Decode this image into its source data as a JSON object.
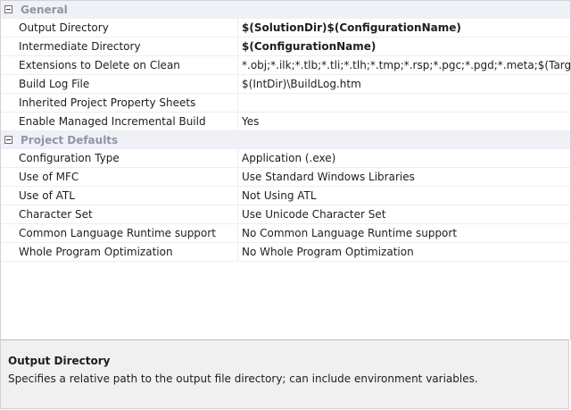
{
  "categories": [
    {
      "title": "General",
      "rows": [
        {
          "name": "Output Directory",
          "value": "$(SolutionDir)$(ConfigurationName)",
          "bold": true
        },
        {
          "name": "Intermediate Directory",
          "value": "$(ConfigurationName)",
          "bold": true
        },
        {
          "name": "Extensions to Delete on Clean",
          "value": "*.obj;*.ilk;*.tlb;*.tli;*.tlh;*.tmp;*.rsp;*.pgc;*.pgd;*.meta;$(TargetPa",
          "bold": false
        },
        {
          "name": "Build Log File",
          "value": "$(IntDir)\\BuildLog.htm",
          "bold": false
        },
        {
          "name": "Inherited Project Property Sheets",
          "value": "",
          "bold": false
        },
        {
          "name": "Enable Managed Incremental Build",
          "value": "Yes",
          "bold": false
        }
      ]
    },
    {
      "title": "Project Defaults",
      "rows": [
        {
          "name": "Configuration Type",
          "value": "Application (.exe)",
          "bold": false
        },
        {
          "name": "Use of MFC",
          "value": "Use Standard Windows Libraries",
          "bold": false
        },
        {
          "name": "Use of ATL",
          "value": "Not Using ATL",
          "bold": false
        },
        {
          "name": "Character Set",
          "value": "Use Unicode Character Set",
          "bold": false
        },
        {
          "name": "Common Language Runtime support",
          "value": "No Common Language Runtime support",
          "bold": false
        },
        {
          "name": "Whole Program Optimization",
          "value": "No Whole Program Optimization",
          "bold": false
        }
      ]
    }
  ],
  "description": {
    "title": "Output Directory",
    "text": "Specifies a relative path to the output file directory; can include environment variables."
  },
  "icons": {
    "collapse": "minus-box-icon"
  }
}
